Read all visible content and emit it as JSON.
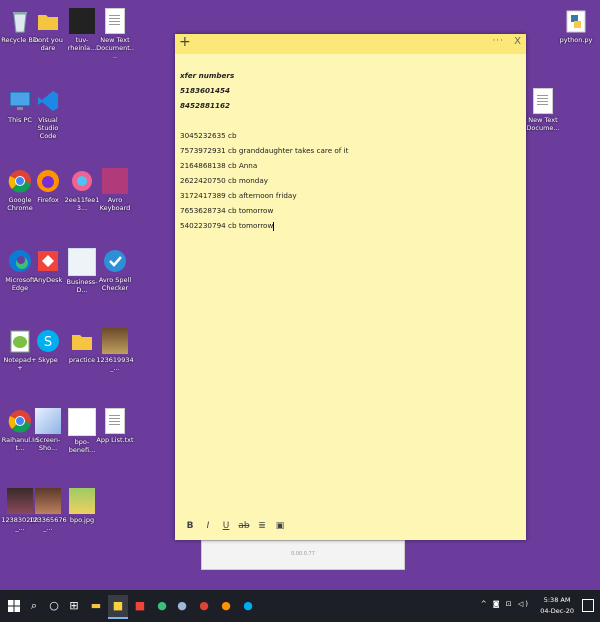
{
  "desktop": {
    "icons": [
      {
        "label": "Recycle Bin"
      },
      {
        "label": "Dont you dare"
      },
      {
        "label": "tuv-rheinla..."
      },
      {
        "label": "New Text Document...."
      },
      {
        "label": "This PC"
      },
      {
        "label": "Visual Studio Code"
      },
      {
        "label": "Google Chrome"
      },
      {
        "label": "Firefox"
      },
      {
        "label": "2ee11fee13..."
      },
      {
        "label": "Avro Keyboard"
      },
      {
        "label": "Microsoft Edge"
      },
      {
        "label": "AnyDesk"
      },
      {
        "label": "Business-D..."
      },
      {
        "label": "Avro Spell Checker"
      },
      {
        "label": "Notepad++"
      },
      {
        "label": "Skype"
      },
      {
        "label": "practice"
      },
      {
        "label": "123619934_..."
      },
      {
        "label": "Raihanul.Int..."
      },
      {
        "label": "Screen-Sho..."
      },
      {
        "label": "bpo-benefi..."
      },
      {
        "label": "App List.txt"
      },
      {
        "label": "123830200_..."
      },
      {
        "label": "123365676_..."
      },
      {
        "label": "bpo.jpg"
      },
      {
        "label": "python.py"
      },
      {
        "label": "New Text Docume..."
      }
    ]
  },
  "background_window": {
    "text": "0.00.0.77"
  },
  "sticky_note": {
    "more_label": "···",
    "close_label": "X",
    "bold_lines": [
      "xfer numbers",
      "5183601454",
      "8452881162"
    ],
    "lines": [
      "3045232635 cb",
      "7573972931 cb granddaughter takes care of it",
      "2164868138 cb Anna",
      "2622420750 cb monday",
      "3172417389 cb afternoon friday",
      "7653628734 cb tomorrow",
      "5402230794 cb tomorrow"
    ],
    "toolbar": [
      "B",
      "I",
      "U",
      "ab",
      "≣",
      "▣"
    ]
  },
  "taskbar": {
    "time": "5:38 AM",
    "date": "04-Dec-20",
    "tray_icons": "^ ◙ ⊡ ◁)"
  }
}
